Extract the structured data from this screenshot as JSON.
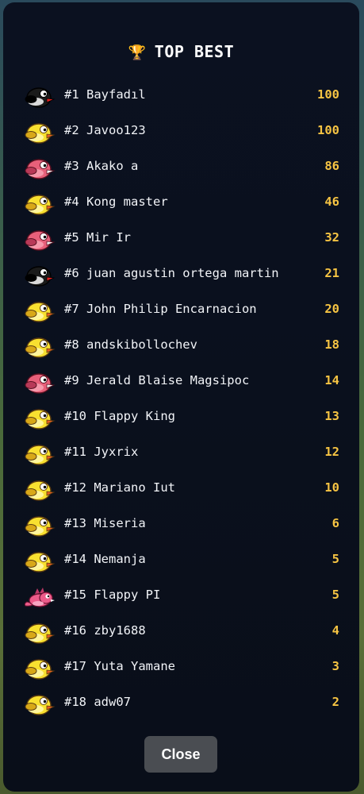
{
  "leaderboard": {
    "title": "TOP BEST",
    "title_icon": "trophy-icon",
    "entries": [
      {
        "rank_name": "#1 Bayfadıl",
        "score": "100",
        "bird": "black"
      },
      {
        "rank_name": "#2 Javoo123",
        "score": "100",
        "bird": "yellow"
      },
      {
        "rank_name": "#3 Akako a",
        "score": "86",
        "bird": "pink"
      },
      {
        "rank_name": "#4 Kong master",
        "score": "46",
        "bird": "yellow"
      },
      {
        "rank_name": "#5 Mir Ir",
        "score": "32",
        "bird": "pink"
      },
      {
        "rank_name": "#6 juan agustin ortega martin",
        "score": "21",
        "bird": "black"
      },
      {
        "rank_name": "#7 John Philip Encarnacion",
        "score": "20",
        "bird": "yellow"
      },
      {
        "rank_name": "#8 andskibollochev",
        "score": "18",
        "bird": "yellow"
      },
      {
        "rank_name": "#9 Jerald Blaise Magsipoc",
        "score": "14",
        "bird": "pink"
      },
      {
        "rank_name": "#10 Flappy King",
        "score": "13",
        "bird": "yellow"
      },
      {
        "rank_name": "#11 Jyxrix",
        "score": "12",
        "bird": "yellow"
      },
      {
        "rank_name": "#12 Mariano Iut",
        "score": "10",
        "bird": "yellow"
      },
      {
        "rank_name": "#13 Miseria",
        "score": "6",
        "bird": "yellow"
      },
      {
        "rank_name": "#14 Nemanja",
        "score": "5",
        "bird": "yellow"
      },
      {
        "rank_name": "#15 Flappy PI",
        "score": "5",
        "bird": "dragon"
      },
      {
        "rank_name": "#16 zby1688",
        "score": "4",
        "bird": "yellow"
      },
      {
        "rank_name": "#17 Yuta Yamane",
        "score": "3",
        "bird": "yellow"
      },
      {
        "rank_name": "#18 adw07",
        "score": "2",
        "bird": "yellow"
      }
    ],
    "close_label": "Close"
  },
  "colors": {
    "panel_bg": "#0b1120",
    "score": "#f6c443",
    "text": "#f2f4f8",
    "close_button": "#4a4d52"
  }
}
